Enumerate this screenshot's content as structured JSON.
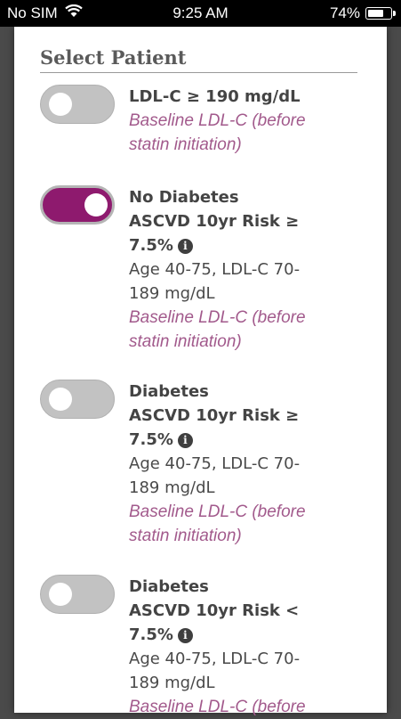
{
  "status": {
    "carrier": "No SIM",
    "time": "9:25 AM",
    "battery": "74%",
    "battery_fraction": 0.74
  },
  "section_title": "Select Patient",
  "options": [
    {
      "toggle_on": false,
      "lines": [
        {
          "text": "LDL-C ≥ 190 mg/dL",
          "style": "bold"
        },
        {
          "text": "Baseline LDL-C (before",
          "style": "pink"
        },
        {
          "text": "statin initiation)",
          "style": "pink"
        }
      ]
    },
    {
      "toggle_on": true,
      "lines": [
        {
          "text": "No Diabetes",
          "style": "bold"
        },
        {
          "text": "ASCVD 10yr Risk ≥",
          "style": "bold"
        },
        {
          "text": "7.5%",
          "style": "bold",
          "info": true
        },
        {
          "text": "Age 40-75, LDL-C 70-",
          "style": "normal"
        },
        {
          "text": "189 mg/dL",
          "style": "normal"
        },
        {
          "text": "Baseline LDL-C (before",
          "style": "pink"
        },
        {
          "text": "statin initiation)",
          "style": "pink"
        }
      ]
    },
    {
      "toggle_on": false,
      "lines": [
        {
          "text": "Diabetes",
          "style": "bold"
        },
        {
          "text": "ASCVD 10yr Risk ≥",
          "style": "bold"
        },
        {
          "text": "7.5%",
          "style": "bold",
          "info": true
        },
        {
          "text": "Age 40-75, LDL-C 70-",
          "style": "normal"
        },
        {
          "text": "189 mg/dL",
          "style": "normal"
        },
        {
          "text": "Baseline LDL-C (before",
          "style": "pink"
        },
        {
          "text": "statin initiation)",
          "style": "pink"
        }
      ]
    },
    {
      "toggle_on": false,
      "lines": [
        {
          "text": "Diabetes",
          "style": "bold"
        },
        {
          "text": "ASCVD 10yr Risk <",
          "style": "bold"
        },
        {
          "text": "7.5%",
          "style": "bold",
          "info": true
        },
        {
          "text": "Age 40-75, LDL-C 70-",
          "style": "normal"
        },
        {
          "text": "189 mg/dL",
          "style": "normal"
        },
        {
          "text": "Baseline LDL-C (before",
          "style": "pink"
        }
      ]
    }
  ],
  "info_icon_glyph": "i",
  "colors": {
    "accent": "#8e1a6e",
    "toggle_off": "#c2c2c2",
    "subtitle_pink": "#a25a8c"
  }
}
